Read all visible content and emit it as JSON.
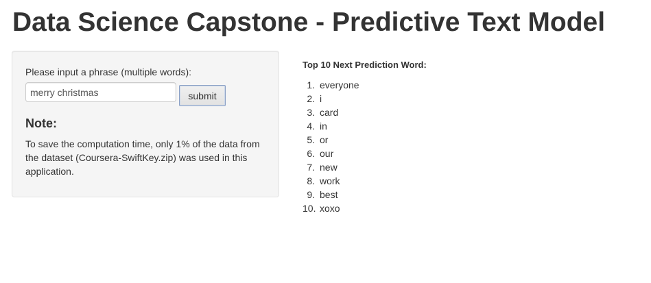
{
  "page": {
    "title": "Data Science Capstone - Predictive Text Model"
  },
  "sidebar": {
    "input_label": "Please input a phrase (multiple words):",
    "input_value": "merry christmas",
    "submit_label": "submit",
    "note_heading": "Note:",
    "note_text": "To save the computation time, only 1% of the data from the dataset (Coursera-SwiftKey.zip) was used in this application."
  },
  "main": {
    "heading": "Top 10 Next Prediction Word:",
    "predictions": [
      {
        "num": "1.",
        "word": "everyone"
      },
      {
        "num": "2.",
        "word": "i"
      },
      {
        "num": "3.",
        "word": "card"
      },
      {
        "num": "4.",
        "word": "in"
      },
      {
        "num": "5.",
        "word": "or"
      },
      {
        "num": "6.",
        "word": "our"
      },
      {
        "num": "7.",
        "word": "new"
      },
      {
        "num": "8.",
        "word": "work"
      },
      {
        "num": "9.",
        "word": "best"
      },
      {
        "num": "10.",
        "word": "xoxo"
      }
    ]
  }
}
